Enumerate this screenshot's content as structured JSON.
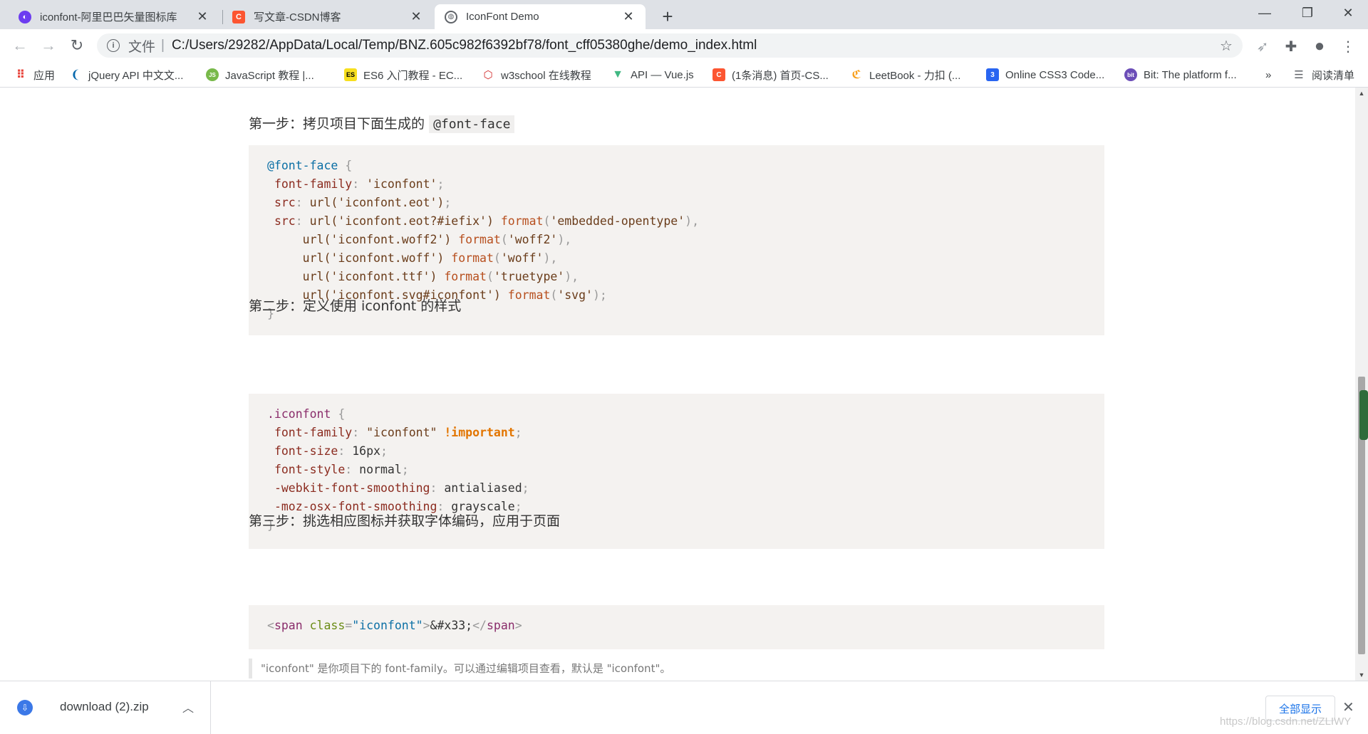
{
  "browser": {
    "tabs": [
      {
        "title": "iconfont-阿里巴巴矢量图标库",
        "icon": "iconfont-logo-icon",
        "color": "#6c3cf0",
        "active": false
      },
      {
        "title": "写文章-CSDN博客",
        "icon": "csdn-logo-icon",
        "color": "#fc5531",
        "active": false
      },
      {
        "title": "IconFont Demo",
        "icon": "globe-icon",
        "color": "#5f6368",
        "active": true
      }
    ],
    "address": {
      "scheme_label": "文件",
      "url": "C:/Users/29282/AppData/Local/Temp/BNZ.605c982f6392bf78/font_cff05380ghe/demo_index.html"
    },
    "bookmarks": [
      {
        "label": "应用",
        "icon": "apps-grid-icon"
      },
      {
        "label": "jQuery API 中文文...",
        "icon": "jquery-icon"
      },
      {
        "label": "JavaScript 教程 |...",
        "icon": "javascript-icon"
      },
      {
        "label": "ES6 入门教程 - EC...",
        "icon": "es6-icon"
      },
      {
        "label": "w3school 在线教程",
        "icon": "w3school-icon"
      },
      {
        "label": "API — Vue.js",
        "icon": "vue-icon"
      },
      {
        "label": "(1条消息) 首页-CS...",
        "icon": "csdn-icon"
      },
      {
        "label": "LeetBook - 力扣 (...",
        "icon": "leetcode-icon"
      },
      {
        "label": "Online CSS3 Code...",
        "icon": "css3-icon"
      },
      {
        "label": "Bit: The platform f...",
        "icon": "bit-icon"
      },
      {
        "label": "»",
        "icon": "overflow-chevron-icon"
      },
      {
        "label": "阅读清单",
        "icon": "reading-list-icon"
      }
    ]
  },
  "page": {
    "step1": {
      "label": "第一步：拷贝项目下面生成的",
      "code": "@font-face"
    },
    "step2": {
      "label": "第二步：定义使用 iconfont 的样式"
    },
    "step3": {
      "label": "第三步：挑选相应图标并获取字体编码，应用于页面"
    },
    "code1": {
      "at_rule": "@font-face",
      "ff_prop": "font-family",
      "ff_val": "'iconfont'",
      "src_prop": "src",
      "src1_url": "url('iconfont.eot')",
      "src2_url": "url('iconfont.eot?#iefix')",
      "src2_fmt": "'embedded-opentype'",
      "src3_url": "url('iconfont.woff2')",
      "src3_fmt": "'woff2'",
      "src4_url": "url('iconfont.woff')",
      "src4_fmt": "'woff'",
      "src5_url": "url('iconfont.ttf')",
      "src5_fmt": "'truetype'",
      "src6_url": "url('iconfont.svg#iconfont')",
      "src6_fmt": "'svg'",
      "format_fn": "format"
    },
    "code2": {
      "selector": ".iconfont",
      "l1_prop": "font-family",
      "l1_val": "\"iconfont\"",
      "l1_imp": "!important",
      "l2_prop": "font-size",
      "l2_val": "16px",
      "l3_prop": "font-style",
      "l3_val": "normal",
      "l4_prop": "-webkit-font-smoothing",
      "l4_val": "antialiased",
      "l5_prop": "-moz-osx-font-smoothing",
      "l5_val": "grayscale"
    },
    "code3": {
      "tag": "span",
      "attr": "class",
      "attr_val": "\"iconfont\"",
      "content": "&#x33;"
    },
    "note": "\"iconfont\" 是你项目下的 font-family。可以通过编辑项目查看，默认是 \"iconfont\"。"
  },
  "downloads": {
    "file_name": "download (2).zip",
    "show_all_label": "全部显示"
  },
  "watermark": "https://blog.csdn.net/ZLIWY"
}
